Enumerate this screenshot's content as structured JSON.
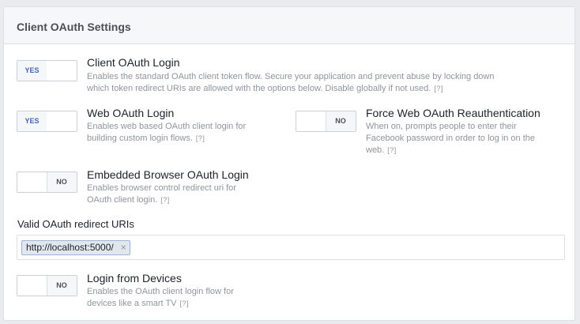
{
  "panel": {
    "title": "Client OAuth Settings"
  },
  "options": {
    "client_oauth_login": {
      "toggle": "YES",
      "title": "Client OAuth Login",
      "desc_line1": "Enables the standard OAuth client token flow. Secure your application and prevent abuse by locking down",
      "desc_line2": "which token redirect URIs are allowed with the options below. Disable globally if not used.",
      "help": "[?]"
    },
    "web_oauth_login": {
      "toggle": "YES",
      "title": "Web OAuth Login",
      "desc_line1": "Enables web based OAuth client login for",
      "desc_line2": "building custom login flows.",
      "help": "[?]"
    },
    "force_web_oauth": {
      "toggle": "NO",
      "title": "Force Web OAuth Reauthentication",
      "desc_line1": "When on, prompts people to enter their",
      "desc_line2": "Facebook password in order to log in on the",
      "desc_line3": "web.",
      "help": "[?]"
    },
    "embedded_browser": {
      "toggle": "NO",
      "title": "Embedded Browser OAuth Login",
      "desc_line1": "Enables browser control redirect uri for",
      "desc_line2": "OAuth client login.",
      "help": "[?]"
    },
    "login_from_devices": {
      "toggle": "NO",
      "title": "Login from Devices",
      "desc_line1": "Enables the OAuth client login flow for",
      "desc_line2": "devices like a smart TV",
      "help": "[?]"
    }
  },
  "redirect_uris": {
    "label": "Valid OAuth redirect URIs",
    "chips": [
      "http://localhost:5000/"
    ],
    "remove_glyph": "×"
  },
  "colors": {
    "accent": "#4267b2",
    "muted": "#90949c",
    "border": "#dddfe2"
  }
}
